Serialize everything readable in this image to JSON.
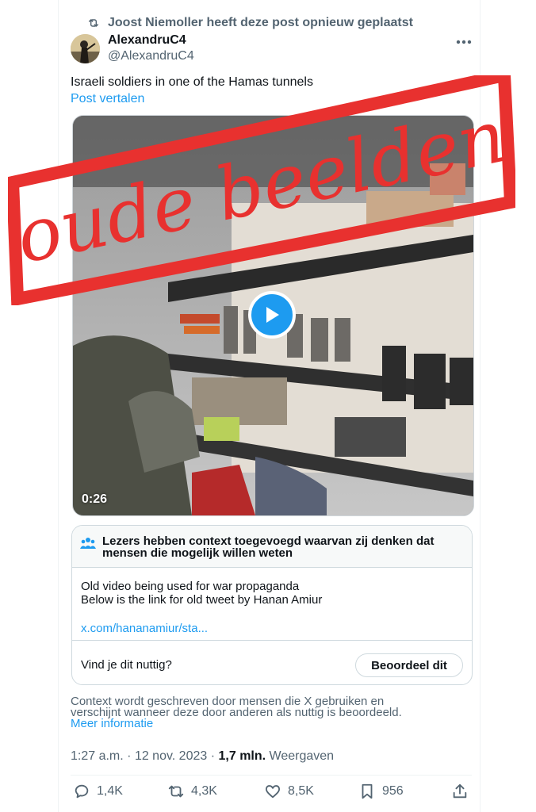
{
  "repost": {
    "text": "Joost Niemoller heeft deze post opnieuw geplaatst"
  },
  "author": {
    "name": "AlexandruC4",
    "handle": "@AlexandruC4"
  },
  "post": {
    "text": "Israeli soldiers in one of the Hamas tunnels",
    "translate_label": "Post vertalen"
  },
  "media": {
    "duration": "0:26"
  },
  "stamp": {
    "text": "oude beelden",
    "color": "#e8312f"
  },
  "note": {
    "title": "Lezers hebben context toegevoegd waarvan zij denken dat mensen die mogelijk willen weten",
    "body_line1": "Old video being used for war propaganda",
    "body_line2": "Below is the link for old tweet by Hanan Amiur",
    "link": "x.com/hananamiur/sta...",
    "question": "Vind je dit nuttig?",
    "rate_label": "Beoordeel dit"
  },
  "context": {
    "line1": "Context wordt geschreven door mensen die X gebruiken en",
    "line2": "verschijnt wanneer deze door anderen als nuttig is beoordeeld.",
    "more_link": "Meer informatie"
  },
  "meta": {
    "time": "1:27 a.m.",
    "separator": "·",
    "date": "12 nov. 2023",
    "views_count": "1,7 mln.",
    "views_label": "Weergaven"
  },
  "actions": {
    "replies": "1,4K",
    "reposts": "4,3K",
    "likes": "8,5K",
    "bookmarks": "956"
  },
  "colors": {
    "accent": "#1d9bf0",
    "muted": "#536471",
    "text": "#0f1419"
  }
}
